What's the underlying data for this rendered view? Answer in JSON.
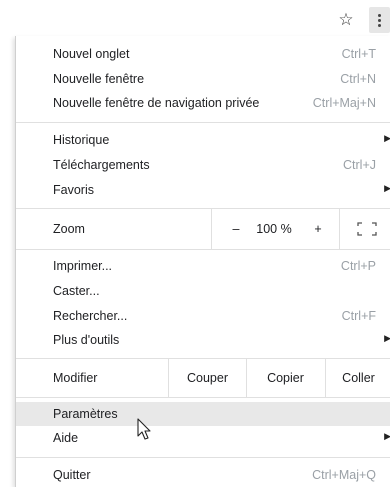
{
  "toolbar": {
    "star_glyph": "☆"
  },
  "menu": {
    "group1": [
      {
        "label": "Nouvel onglet",
        "shortcut": "Ctrl+T"
      },
      {
        "label": "Nouvelle fenêtre",
        "shortcut": "Ctrl+N"
      },
      {
        "label": "Nouvelle fenêtre de navigation privée",
        "shortcut": "Ctrl+Maj+N"
      }
    ],
    "group2": [
      {
        "label": "Historique",
        "shortcut": ""
      },
      {
        "label": "Téléchargements",
        "shortcut": "Ctrl+J"
      },
      {
        "label": "Favoris",
        "shortcut": ""
      }
    ],
    "zoom": {
      "label": "Zoom",
      "minus": "–",
      "value": "100 %",
      "plus": "+",
      "fullscreen_icon": "fullscreen-icon"
    },
    "group3": [
      {
        "label": "Imprimer...",
        "shortcut": "Ctrl+P"
      },
      {
        "label": "Caster...",
        "shortcut": ""
      },
      {
        "label": "Rechercher...",
        "shortcut": "Ctrl+F"
      },
      {
        "label": "Plus d'outils",
        "shortcut": ""
      }
    ],
    "edit": {
      "label": "Modifier",
      "cut": "Couper",
      "copy": "Copier",
      "paste": "Coller"
    },
    "group4": [
      {
        "label": "Paramètres",
        "shortcut": ""
      },
      {
        "label": "Aide",
        "shortcut": ""
      }
    ],
    "quit": {
      "label": "Quitter",
      "shortcut": "Ctrl+Maj+Q"
    }
  }
}
